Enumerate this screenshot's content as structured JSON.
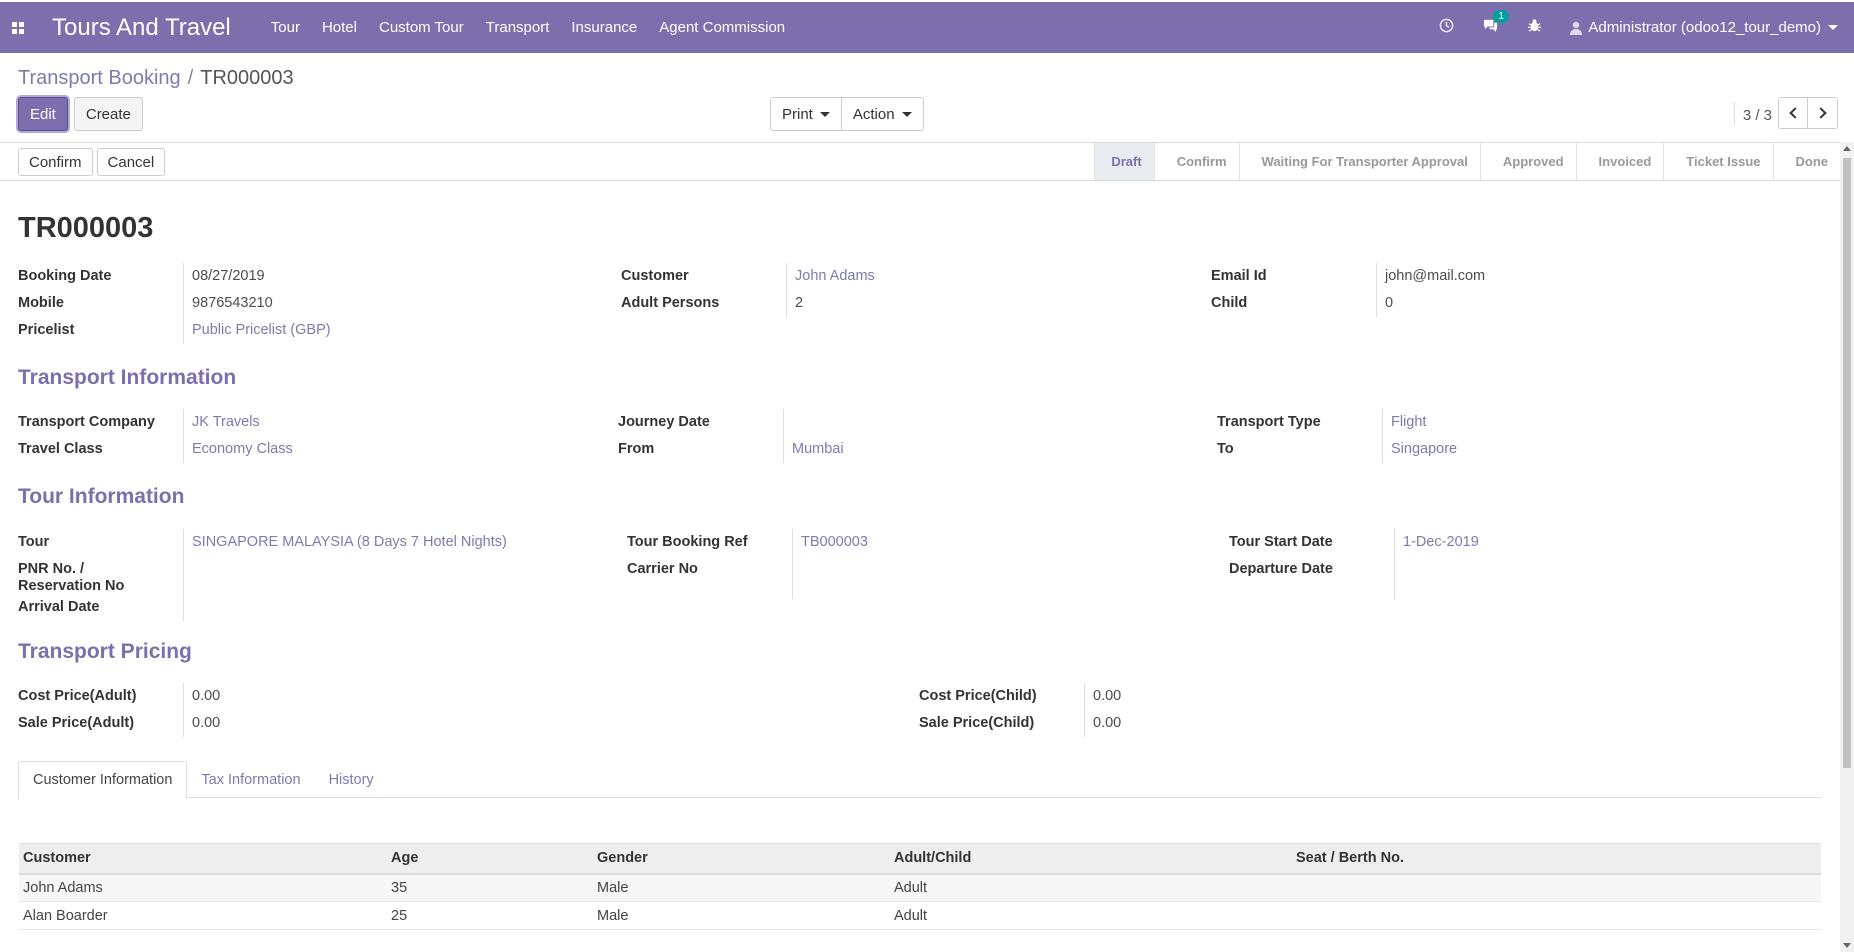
{
  "navbar": {
    "brand": "Tours And Travel",
    "menu": [
      "Tour",
      "Hotel",
      "Custom Tour",
      "Transport",
      "Insurance",
      "Agent Commission"
    ],
    "messages_count": "1",
    "user": "Administrator (odoo12_tour_demo)"
  },
  "breadcrumb": {
    "parent": "Transport Booking",
    "current": "TR000003"
  },
  "buttons": {
    "edit": "Edit",
    "create": "Create",
    "print": "Print",
    "action": "Action",
    "confirm": "Confirm",
    "cancel": "Cancel"
  },
  "pager": {
    "value": "3 / 3"
  },
  "stages": [
    "Draft",
    "Confirm",
    "Waiting For Transporter Approval",
    "Approved",
    "Invoiced",
    "Ticket Issue",
    "Done"
  ],
  "record": {
    "name": "TR000003",
    "booking_date_label": "Booking Date",
    "booking_date": "08/27/2019",
    "mobile_label": "Mobile",
    "mobile": "9876543210",
    "pricelist_label": "Pricelist",
    "pricelist": "Public Pricelist (GBP)",
    "customer_label": "Customer",
    "customer": "John Adams",
    "adult_label": "Adult Persons",
    "adult": "2",
    "email_label": "Email Id",
    "email": "john@mail.com",
    "child_label": "Child",
    "child": "0"
  },
  "transport": {
    "title": "Transport Information",
    "company_label": "Transport Company",
    "company": "JK Travels",
    "class_label": "Travel Class",
    "class": "Economy Class",
    "journey_label": "Journey Date",
    "journey": "",
    "from_label": "From",
    "from": "Mumbai",
    "type_label": "Transport Type",
    "type": "Flight",
    "to_label": "To",
    "to": "Singapore"
  },
  "tour": {
    "title": "Tour Information",
    "tour_label": "Tour",
    "tour": "SINGAPORE MALAYSIA (8 Days 7 Hotel Nights)",
    "pnr_label_1": "PNR No. /",
    "pnr_label_2": "Reservation No",
    "arrival_label": "Arrival Date",
    "ref_label": "Tour Booking Ref",
    "ref": "TB000003",
    "carrier_label": "Carrier No",
    "start_label": "Tour Start Date",
    "start": "1-Dec-2019",
    "departure_label": "Departure Date"
  },
  "pricing": {
    "title": "Transport Pricing",
    "cost_adult_label": "Cost Price(Adult)",
    "cost_adult": "0.00",
    "sale_adult_label": "Sale Price(Adult)",
    "sale_adult": "0.00",
    "cost_child_label": "Cost Price(Child)",
    "cost_child": "0.00",
    "sale_child_label": "Sale Price(Child)",
    "sale_child": "0.00"
  },
  "tabs": [
    "Customer Information",
    "Tax Information",
    "History"
  ],
  "table": {
    "headers": [
      "Customer",
      "Age",
      "Gender",
      "Adult/Child",
      "Seat / Berth No."
    ],
    "rows": [
      [
        "John Adams",
        "35",
        "Male",
        "Adult",
        ""
      ],
      [
        "Alan Boarder",
        "25",
        "Male",
        "Adult",
        ""
      ]
    ]
  },
  "colors": {
    "brand": "#7c6fae",
    "link": "#7c7bad"
  }
}
